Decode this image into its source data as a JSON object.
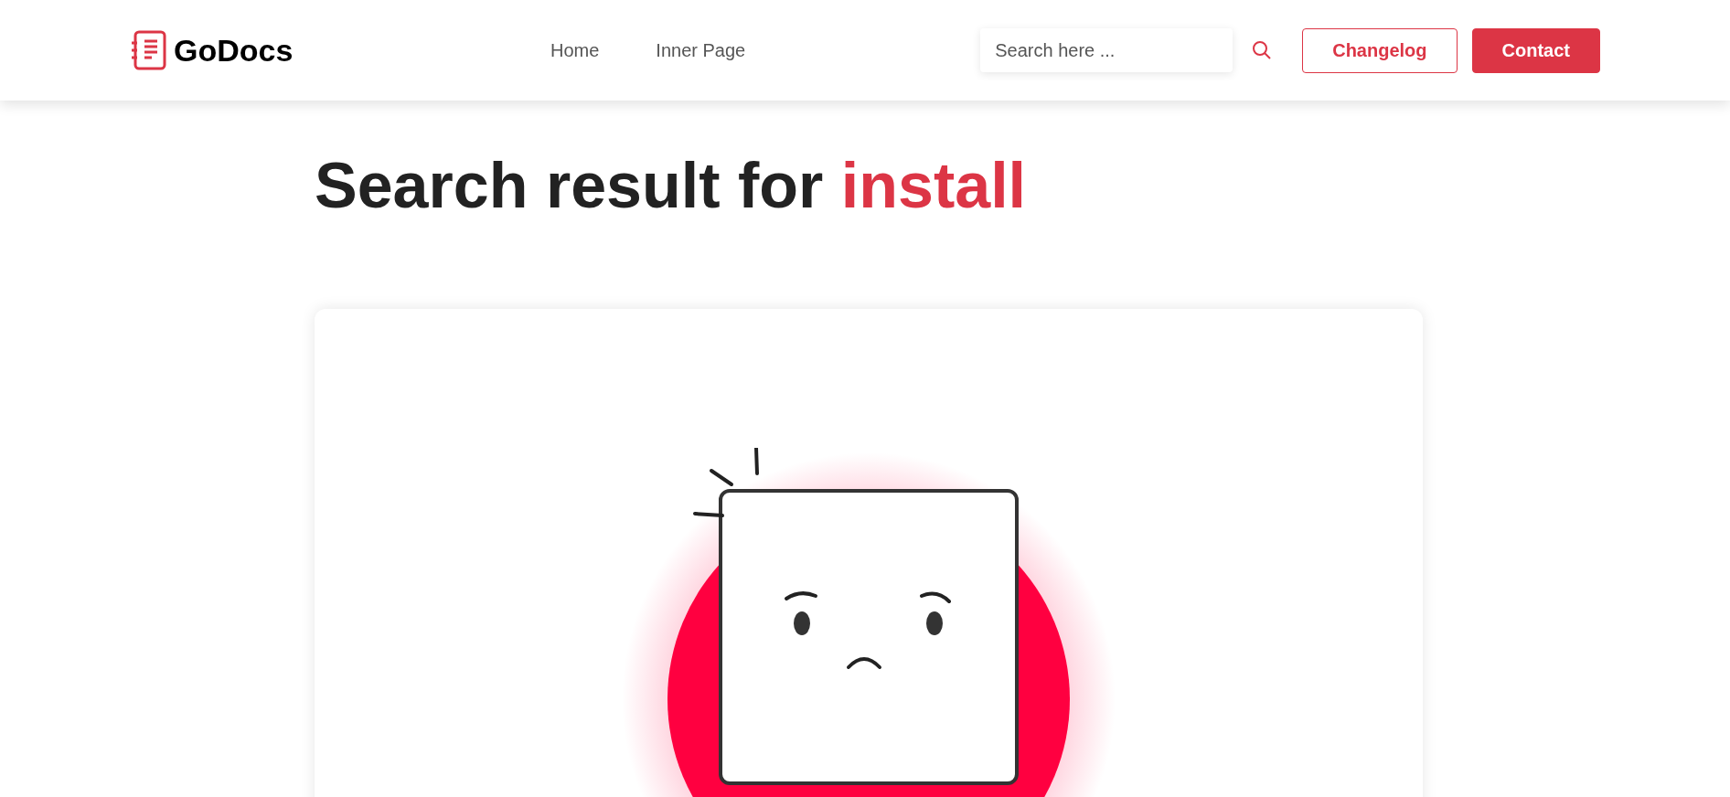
{
  "header": {
    "logo": "GoDocs",
    "nav": [
      {
        "label": "Home"
      },
      {
        "label": "Inner Page"
      }
    ],
    "search": {
      "placeholder": "Search here ..."
    },
    "buttons": [
      {
        "label": "Changelog",
        "kind": "outline"
      },
      {
        "label": "Contact",
        "kind": "solid"
      }
    ]
  },
  "heading": {
    "text": "Search result for",
    "query": "install"
  },
  "result": {
    "kind": "empty"
  }
}
